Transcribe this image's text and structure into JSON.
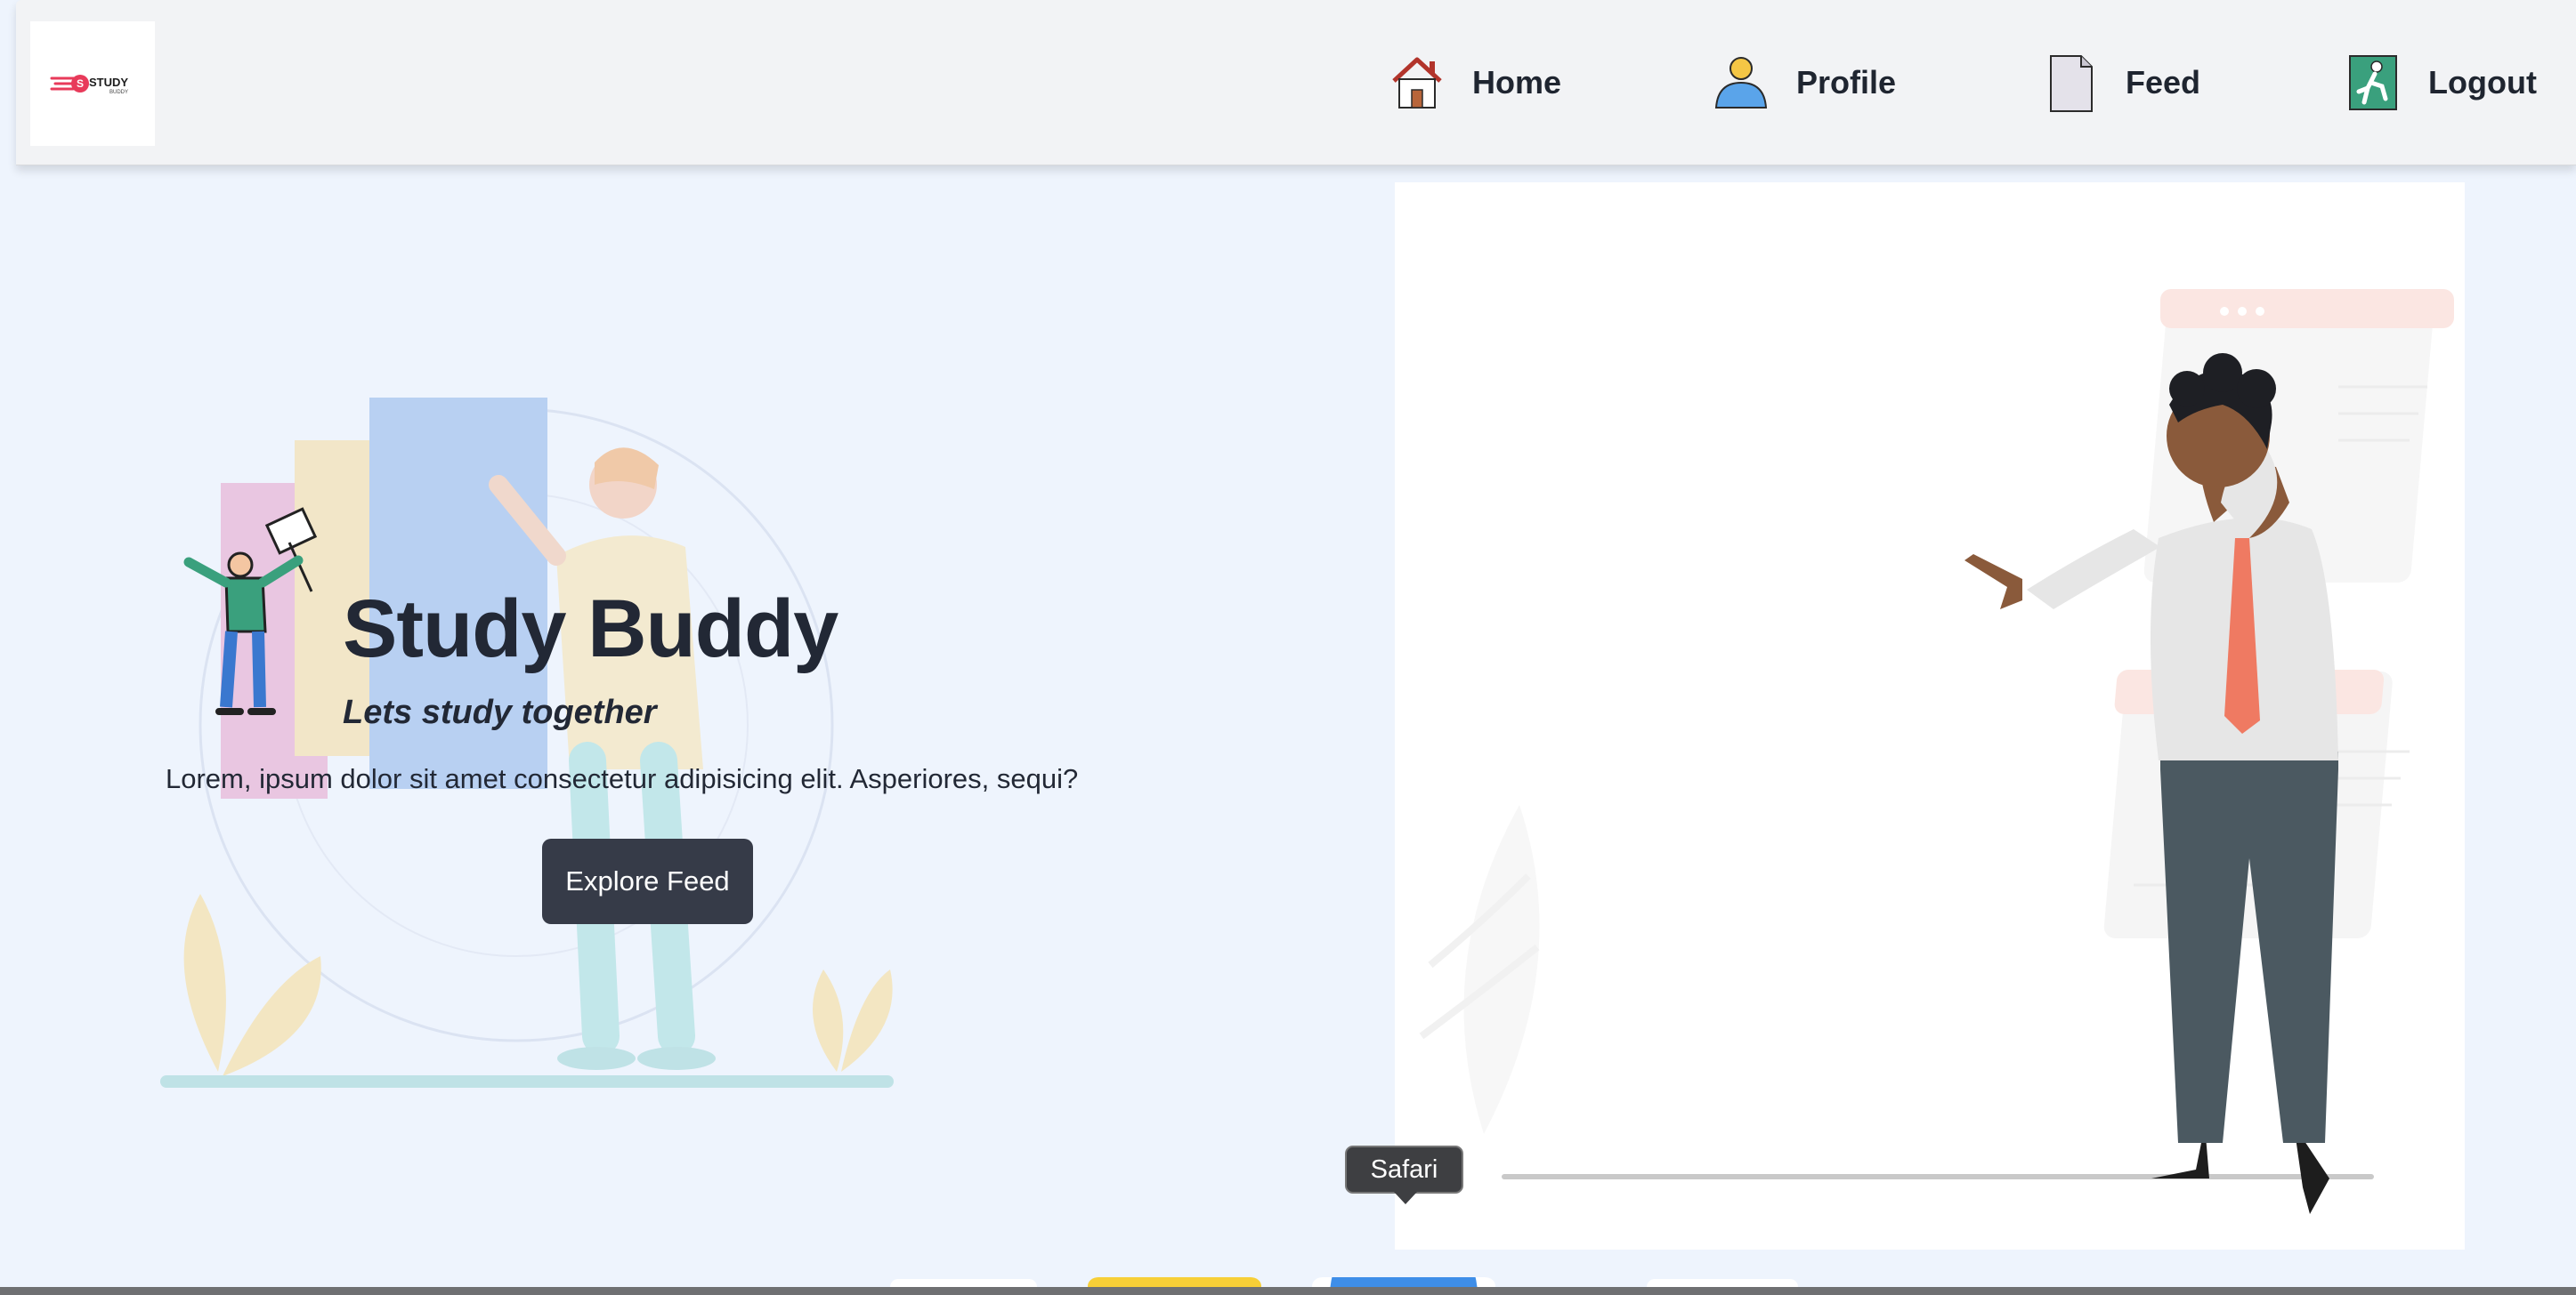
{
  "navbar": {
    "logo": {
      "text": "STUDY",
      "subtext": "BUDDY"
    },
    "items": [
      {
        "label": "Home",
        "icon": "house-icon"
      },
      {
        "label": "Profile",
        "icon": "user-icon"
      },
      {
        "label": "Feed",
        "icon": "document-icon"
      },
      {
        "label": "Logout",
        "icon": "exit-door-icon"
      }
    ]
  },
  "hero": {
    "title": "Study Buddy",
    "tagline": "Lets study together",
    "lead": "Lorem, ipsum dolor sit amet consectetur adipisicing elit. Asperiores, sequi?",
    "cta_label": "Explore Feed"
  },
  "dock": {
    "tooltip": "Safari",
    "items": [
      "finder-icon",
      "notes-icon",
      "safari-icon",
      "app-icon"
    ]
  },
  "colors": {
    "page_bg": "#eef4fd",
    "navbar_bg": "#f2f3f5",
    "button_bg": "#363b48",
    "text": "#222835"
  }
}
